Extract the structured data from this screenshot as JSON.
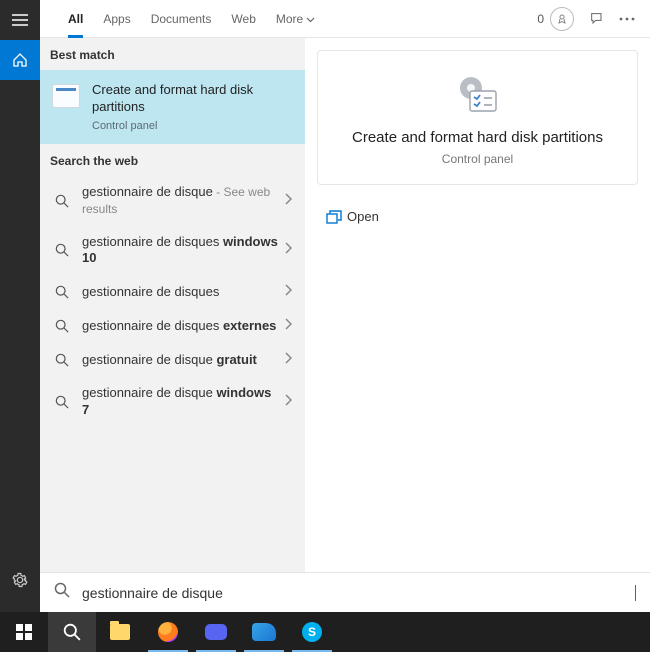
{
  "rail": {
    "menu": "menu",
    "home": "home",
    "settings": "settings"
  },
  "tabs": {
    "all": "All",
    "apps": "Apps",
    "documents": "Documents",
    "web": "Web",
    "more": "More"
  },
  "top": {
    "count": "0"
  },
  "sections": {
    "best_match": "Best match",
    "search_web": "Search the web"
  },
  "best_match": {
    "title": "Create and format hard disk partitions",
    "subtitle": "Control panel"
  },
  "web_results": [
    {
      "prefix": "gestionnaire de disque",
      "bold": "",
      "hint": " - See web results"
    },
    {
      "prefix": "gestionnaire de disques ",
      "bold": "windows 10",
      "hint": ""
    },
    {
      "prefix": "gestionnaire de disques",
      "bold": "",
      "hint": ""
    },
    {
      "prefix": "gestionnaire de disques ",
      "bold": "externes",
      "hint": ""
    },
    {
      "prefix": "gestionnaire de disque ",
      "bold": "gratuit",
      "hint": ""
    },
    {
      "prefix": "gestionnaire de disque ",
      "bold": "windows 7",
      "hint": ""
    }
  ],
  "detail": {
    "title": "Create and format hard disk partitions",
    "subtitle": "Control panel",
    "open": "Open"
  },
  "search": {
    "value": "gestionnaire de disque"
  }
}
